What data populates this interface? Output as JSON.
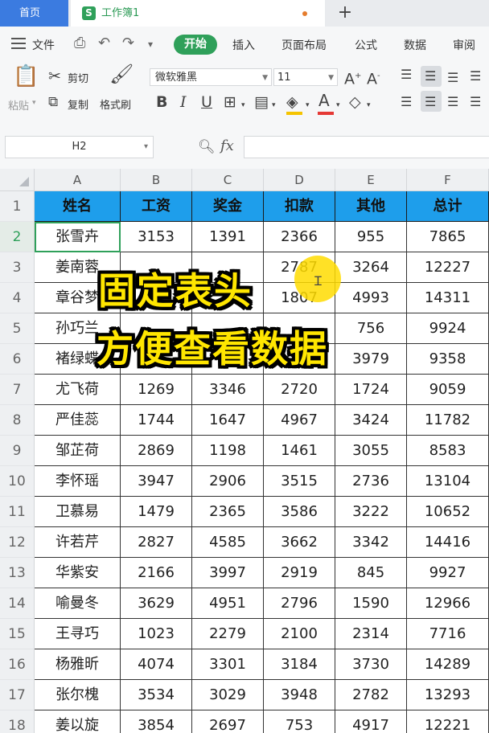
{
  "tabs": {
    "home": "首页",
    "doc_logo": "S",
    "doc_name": "工作簿1",
    "plus": "+"
  },
  "menu": {
    "file": "文件",
    "start": "开始",
    "items": [
      "插入",
      "页面布局",
      "公式",
      "数据",
      "审阅"
    ]
  },
  "ribbon": {
    "paste": "粘贴",
    "cut": "剪切",
    "copy": "复制",
    "format_painter": "格式刷",
    "font_name": "微软雅黑",
    "font_size": "11",
    "bold": "B",
    "italic": "I",
    "underline": "U",
    "font_color_glyph": "A"
  },
  "formula_bar": {
    "cell_ref": "H2",
    "fx": "fx",
    "value": ""
  },
  "grid": {
    "columns": [
      "A",
      "B",
      "C",
      "D",
      "E",
      "F"
    ],
    "row_numbers": [
      "1",
      "2",
      "3",
      "4",
      "5",
      "6",
      "7",
      "8",
      "9",
      "10",
      "11",
      "12",
      "13",
      "14",
      "15",
      "16",
      "17",
      "18"
    ],
    "header": [
      "姓名",
      "工资",
      "奖金",
      "扣款",
      "其他",
      "总计"
    ],
    "rows": [
      [
        "张雪卉",
        "3153",
        "1391",
        "2366",
        "955",
        "7865"
      ],
      [
        "姜南蓉",
        "",
        "",
        "2787",
        "3264",
        "12227"
      ],
      [
        "章谷梦",
        "",
        "",
        "1807",
        "4993",
        "14311"
      ],
      [
        "孙巧兰",
        "",
        "",
        "",
        "756",
        "9924"
      ],
      [
        "褚绿蝶",
        "",
        "",
        "",
        "3979",
        "9358"
      ],
      [
        "尤飞荷",
        "1269",
        "3346",
        "2720",
        "1724",
        "9059"
      ],
      [
        "严佳蕊",
        "1744",
        "1647",
        "4967",
        "3424",
        "11782"
      ],
      [
        "邹芷荷",
        "2869",
        "1198",
        "1461",
        "3055",
        "8583"
      ],
      [
        "李怀瑶",
        "3947",
        "2906",
        "3515",
        "2736",
        "13104"
      ],
      [
        "卫慕易",
        "1479",
        "2365",
        "3586",
        "3222",
        "10652"
      ],
      [
        "许若芹",
        "2827",
        "4585",
        "3662",
        "3342",
        "14416"
      ],
      [
        "华紫安",
        "2166",
        "3997",
        "2919",
        "845",
        "9927"
      ],
      [
        "喻曼冬",
        "3629",
        "4951",
        "2796",
        "1590",
        "12966"
      ],
      [
        "王寻巧",
        "1023",
        "2279",
        "2100",
        "2314",
        "7716"
      ],
      [
        "杨雅昕",
        "4074",
        "3301",
        "3184",
        "3730",
        "14289"
      ],
      [
        "张尔槐",
        "3534",
        "3029",
        "3948",
        "2782",
        "13293"
      ],
      [
        "姜以旋",
        "3854",
        "2697",
        "753",
        "4917",
        "12221"
      ]
    ]
  },
  "overlay": {
    "line1": "固定表头",
    "line2": "方便查看数据"
  },
  "colors": {
    "accent": "#2fa05a",
    "header_fill": "#1e9eeb",
    "home_tab": "#3b7be0",
    "caption": "#ffe600"
  }
}
